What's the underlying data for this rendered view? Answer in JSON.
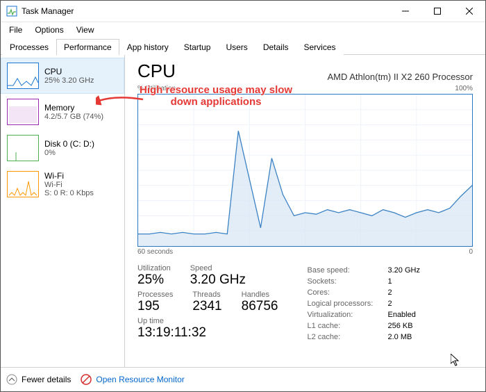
{
  "window": {
    "title": "Task Manager"
  },
  "menus": [
    "File",
    "Options",
    "View"
  ],
  "tabs": [
    "Processes",
    "Performance",
    "App history",
    "Startup",
    "Users",
    "Details",
    "Services"
  ],
  "active_tab": 1,
  "sidebar": [
    {
      "title": "CPU",
      "sub": "25%  3.20 GHz",
      "kind": "cpu",
      "selected": true
    },
    {
      "title": "Memory",
      "sub": "4.2/5.7 GB (74%)",
      "kind": "mem",
      "selected": false
    },
    {
      "title": "Disk 0 (C: D:)",
      "sub": "0%",
      "kind": "disk",
      "selected": false
    },
    {
      "title": "Wi-Fi",
      "sub": "Wi-Fi",
      "sub2": "S: 0  R: 0 Kbps",
      "kind": "wifi",
      "selected": false
    }
  ],
  "main": {
    "heading": "CPU",
    "sub": "AMD Athlon(tm) II X2 260 Processor",
    "chart_top_left": "% Utilization",
    "chart_top_right": "100%",
    "chart_bot_left": "60 seconds",
    "chart_bot_right": "0",
    "stats": {
      "util_label": "Utilization",
      "util": "25%",
      "speed_label": "Speed",
      "speed": "3.20 GHz",
      "procs_label": "Processes",
      "procs": "195",
      "threads_label": "Threads",
      "threads": "2341",
      "handles_label": "Handles",
      "handles": "86756",
      "uptime_label": "Up time",
      "uptime": "13:19:11:32"
    },
    "kv": [
      [
        "Base speed:",
        "3.20 GHz"
      ],
      [
        "Sockets:",
        "1"
      ],
      [
        "Cores:",
        "2"
      ],
      [
        "Logical processors:",
        "2"
      ],
      [
        "Virtualization:",
        "Enabled"
      ],
      [
        "L1 cache:",
        "256 KB"
      ],
      [
        "L2 cache:",
        "2.0 MB"
      ]
    ]
  },
  "footer": {
    "fewer": "Fewer details",
    "orm": "Open Resource Monitor"
  },
  "annotation": {
    "line1": "High resource usage may slow",
    "line2": "down applications"
  },
  "chart_data": {
    "type": "line",
    "title": "% Utilization",
    "xlabel": "60 seconds → 0",
    "ylabel": "% Utilization",
    "ylim": [
      0,
      100
    ],
    "x_seconds_ago": [
      60,
      58,
      56,
      54,
      52,
      50,
      48,
      46,
      44,
      42,
      40,
      38,
      36,
      34,
      32,
      30,
      28,
      26,
      24,
      22,
      20,
      18,
      16,
      14,
      12,
      10,
      8,
      6,
      4,
      2,
      0
    ],
    "values": [
      8,
      8,
      9,
      8,
      9,
      8,
      8,
      9,
      8,
      76,
      44,
      12,
      58,
      34,
      20,
      22,
      21,
      24,
      22,
      24,
      22,
      20,
      24,
      22,
      19,
      22,
      24,
      22,
      25,
      33,
      40
    ],
    "color": "#3b82c4",
    "fill": true
  }
}
